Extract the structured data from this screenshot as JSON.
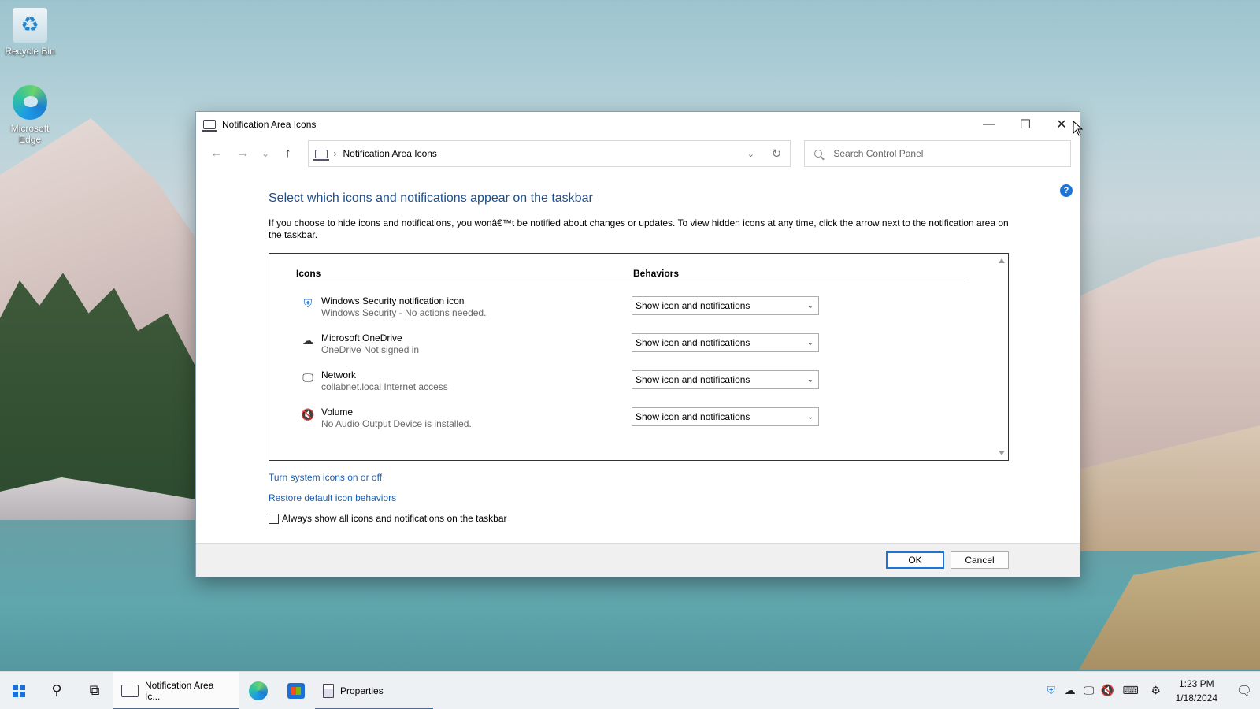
{
  "desktop": {
    "icons": [
      {
        "label": "Recycle Bin"
      },
      {
        "label": "Microsoft Edge"
      }
    ]
  },
  "window": {
    "title": "Notification Area Icons",
    "controls": {
      "minimize": "—",
      "maximize": "☐",
      "close": "✕"
    }
  },
  "navbar": {
    "back": "←",
    "forward": "→",
    "recent": "⌄",
    "up": "↑",
    "address_sep": "›",
    "address_text": "Notification Area Icons",
    "dropdown": "⌄",
    "refresh": "↻",
    "search_placeholder": "Search Control Panel"
  },
  "help": "?",
  "content": {
    "heading": "Select which icons and notifications appear on the taskbar",
    "description": "If you choose to hide icons and notifications, you wonâ€™t be notified about changes or updates. To view hidden icons at any time, click the arrow next to the notification area on the taskbar.",
    "columns": {
      "icons": "Icons",
      "behaviors": "Behaviors"
    },
    "rows": [
      {
        "name": "Windows Security notification icon",
        "sub": "Windows Security - No actions needed.",
        "behavior": "Show icon and notifications",
        "icon": "shield-icon"
      },
      {
        "name": "Microsoft OneDrive",
        "sub": "OneDrive Not signed in",
        "behavior": "Show icon and notifications",
        "icon": "cloud-icon"
      },
      {
        "name": "Network",
        "sub": "collabnet.local Internet access",
        "behavior": "Show icon and notifications",
        "icon": "network-icon"
      },
      {
        "name": "Volume",
        "sub": "No Audio Output Device is installed.",
        "behavior": "Show icon and notifications",
        "icon": "volume-muted-icon"
      }
    ],
    "links": {
      "system_icons": "Turn system icons on or off",
      "restore": "Restore default icon behaviors"
    },
    "checkbox_label": "Always show all icons and notifications on the taskbar",
    "checkbox_checked": false
  },
  "footer": {
    "ok": "OK",
    "cancel": "Cancel"
  },
  "taskbar": {
    "apps": [
      {
        "label": "Notification Area Ic..."
      },
      {
        "label": "Properties"
      }
    ],
    "clock": {
      "time": "1:23 PM",
      "date": "1/18/2024"
    }
  },
  "colors": {
    "accent": "#1e73d4",
    "heading": "#1f4e8c",
    "link": "#1a5fb4"
  }
}
